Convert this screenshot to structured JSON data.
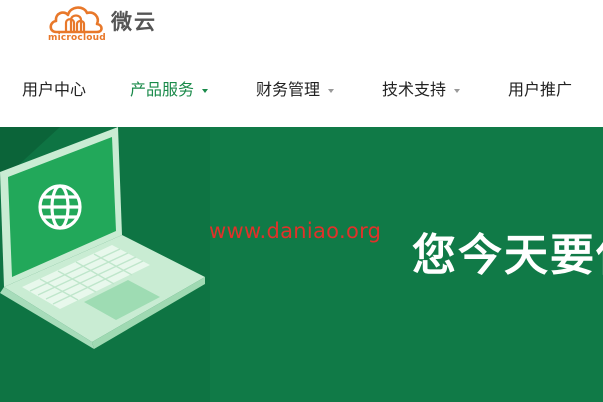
{
  "brand": {
    "name": "微云",
    "sub": "microcloud",
    "accent": "#e8782a"
  },
  "nav": {
    "items": [
      {
        "label": "用户中心",
        "dropdown": false,
        "active": false
      },
      {
        "label": "产品服务",
        "dropdown": true,
        "active": true
      },
      {
        "label": "财务管理",
        "dropdown": true,
        "active": false
      },
      {
        "label": "技术支持",
        "dropdown": true,
        "active": false
      },
      {
        "label": "用户推广",
        "dropdown": false,
        "active": false
      }
    ],
    "active_color": "#1a8a4a"
  },
  "banner": {
    "background": "#107a47",
    "watermark": "www.daniao.org",
    "headline": "您今天要使"
  },
  "icons": {
    "logo": "cloud-logo-icon",
    "laptop": "laptop-globe-illustration"
  }
}
